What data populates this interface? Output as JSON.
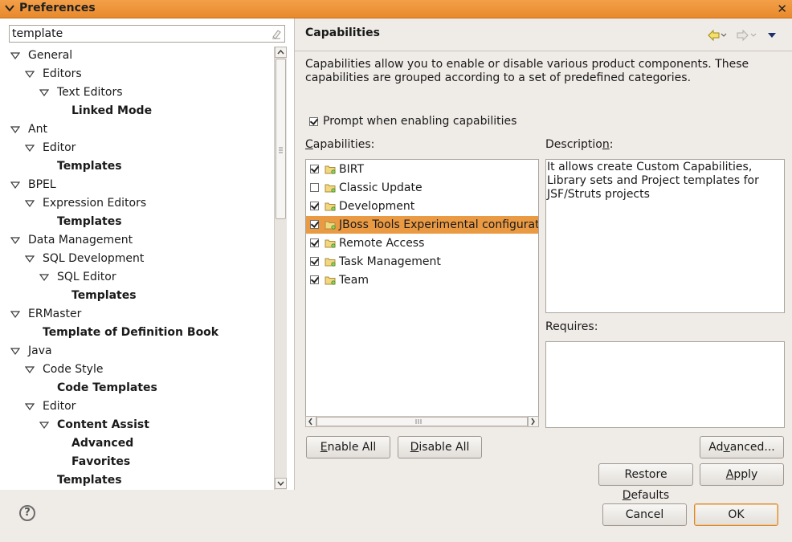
{
  "window": {
    "title": "Preferences",
    "close_glyph": "✕"
  },
  "filter": {
    "value": "template"
  },
  "tree": [
    {
      "label": "General",
      "level": 0,
      "expanded": true,
      "bold": false
    },
    {
      "label": "Editors",
      "level": 1,
      "expanded": true,
      "bold": false
    },
    {
      "label": "Text Editors",
      "level": 2,
      "expanded": true,
      "bold": false
    },
    {
      "label": "Linked Mode",
      "level": 3,
      "expanded": null,
      "bold": true
    },
    {
      "label": "Ant",
      "level": 0,
      "expanded": true,
      "bold": false
    },
    {
      "label": "Editor",
      "level": 1,
      "expanded": true,
      "bold": false
    },
    {
      "label": "Templates",
      "level": 2,
      "expanded": null,
      "bold": true
    },
    {
      "label": "BPEL",
      "level": 0,
      "expanded": true,
      "bold": false
    },
    {
      "label": "Expression Editors",
      "level": 1,
      "expanded": true,
      "bold": false
    },
    {
      "label": "Templates",
      "level": 2,
      "expanded": null,
      "bold": true
    },
    {
      "label": "Data Management",
      "level": 0,
      "expanded": true,
      "bold": false
    },
    {
      "label": "SQL Development",
      "level": 1,
      "expanded": true,
      "bold": false
    },
    {
      "label": "SQL Editor",
      "level": 2,
      "expanded": true,
      "bold": false
    },
    {
      "label": "Templates",
      "level": 3,
      "expanded": null,
      "bold": true
    },
    {
      "label": "ERMaster",
      "level": 0,
      "expanded": true,
      "bold": false
    },
    {
      "label": "Template of Definition Book",
      "level": 1,
      "expanded": null,
      "bold": true
    },
    {
      "label": "Java",
      "level": 0,
      "expanded": true,
      "bold": false
    },
    {
      "label": "Code Style",
      "level": 1,
      "expanded": true,
      "bold": false
    },
    {
      "label": "Code Templates",
      "level": 2,
      "expanded": null,
      "bold": true
    },
    {
      "label": "Editor",
      "level": 1,
      "expanded": true,
      "bold": false
    },
    {
      "label": "Content Assist",
      "level": 2,
      "expanded": true,
      "bold": true
    },
    {
      "label": "Advanced",
      "level": 3,
      "expanded": null,
      "bold": true
    },
    {
      "label": "Favorites",
      "level": 3,
      "expanded": null,
      "bold": true
    },
    {
      "label": "Templates",
      "level": 2,
      "expanded": null,
      "bold": true
    }
  ],
  "page": {
    "title": "Capabilities",
    "description": "Capabilities allow you to enable or disable various product components.  These capabilities are grouped according to a set of predefined categories.",
    "prompt_label": "Prompt when enabling capabilities",
    "prompt_checked": true,
    "capabilities_label": "Capabilities:",
    "description_label": "Description:",
    "requires_label": "Requires:",
    "capabilities": [
      {
        "label": "BIRT",
        "checked": true,
        "selected": false
      },
      {
        "label": "Classic Update",
        "checked": false,
        "selected": false
      },
      {
        "label": "Development",
        "checked": true,
        "selected": false
      },
      {
        "label": "JBoss Tools Experimental configuration",
        "checked": true,
        "selected": true
      },
      {
        "label": "Remote Access",
        "checked": true,
        "selected": false
      },
      {
        "label": "Task Management",
        "checked": true,
        "selected": false
      },
      {
        "label": "Team",
        "checked": true,
        "selected": false
      }
    ],
    "description_text": "It allows create Custom Capabilities, Library sets and Project templates for JSF/Struts projects",
    "requires_text": "",
    "buttons": {
      "enable_all": "Enable All",
      "disable_all": "Disable All",
      "advanced": "Advanced...",
      "restore_defaults": "Restore Defaults",
      "apply": "Apply"
    }
  },
  "footer": {
    "help_glyph": "?",
    "cancel": "Cancel",
    "ok": "OK"
  },
  "colors": {
    "selection": "#eb9a44",
    "titlebar": "#e8892c"
  }
}
